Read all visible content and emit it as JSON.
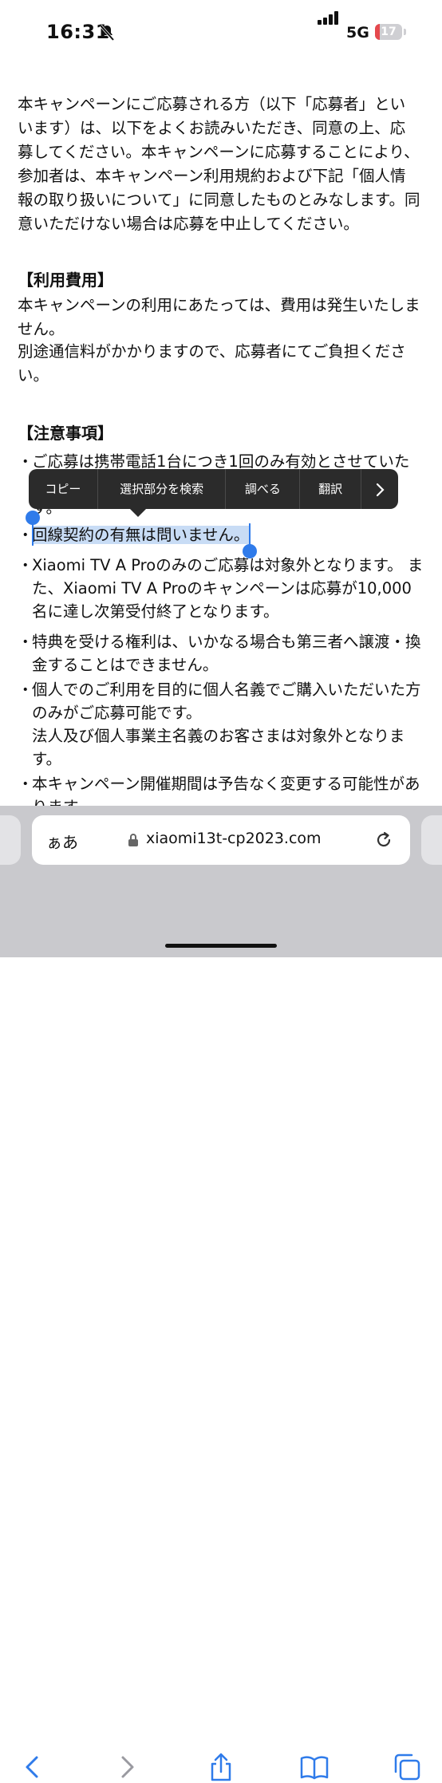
{
  "status_bar": {
    "time": "16:31",
    "network": "5G",
    "battery": "17",
    "battery_level": 0.17
  },
  "article": {
    "intro": "本キャンペーンにご応募される方（以下「応募者」といいます）は、以下をよくお読みいただき、同意の上、応募してください。本キャンペーンに応募することにより、参加者は、本キャンペーン利用規約および下記「個人情報の取り扱いについて」に同意したものとみなします。同意いただけない場合は応募を中止してください。",
    "section_fee": {
      "heading": "【利用費用】",
      "line1": "本キャンペーンの利用にあたっては、費用は発生いたしません。",
      "line2": "別途通信料がかかりますので、応募者にてご負担ください。"
    },
    "section_notes": {
      "heading": "【注意事項】",
      "bullet_mark": "・",
      "items": [
        "ご応募は携帯電話1台につき1回のみ有効とさせていただきます。それぞれ1回のみ有効とさせていただきます。",
        "回線契約の有無は問いません。",
        "Xiaomi TV A Proのみのご応募は対象外となります。 また、Xiaomi TV A Proのキャンペーンは応募が10,000名に達し次第受付終了となります。",
        "特典を受ける権利は、いかなる場合も第三者へ譲渡・換金することはできません。",
        "個人でのご利用を目的に個人名義でご購入いただいた方のみがご応募可能です。",
        "法人及び個人事業主名義のお客さまは対象外となります。",
        "本キャンペーン開催期間は予告なく変更する可能性があります。"
      ]
    }
  },
  "context_menu": {
    "items": [
      "コピー",
      "選択部分を検索",
      "調べる",
      "翻訳"
    ],
    "more_icon": "chevron-right-icon"
  },
  "browser": {
    "text_size_label": "ぁあ",
    "url": "xiaomi13t-cp2023.com",
    "accent": "#2f7bea"
  }
}
